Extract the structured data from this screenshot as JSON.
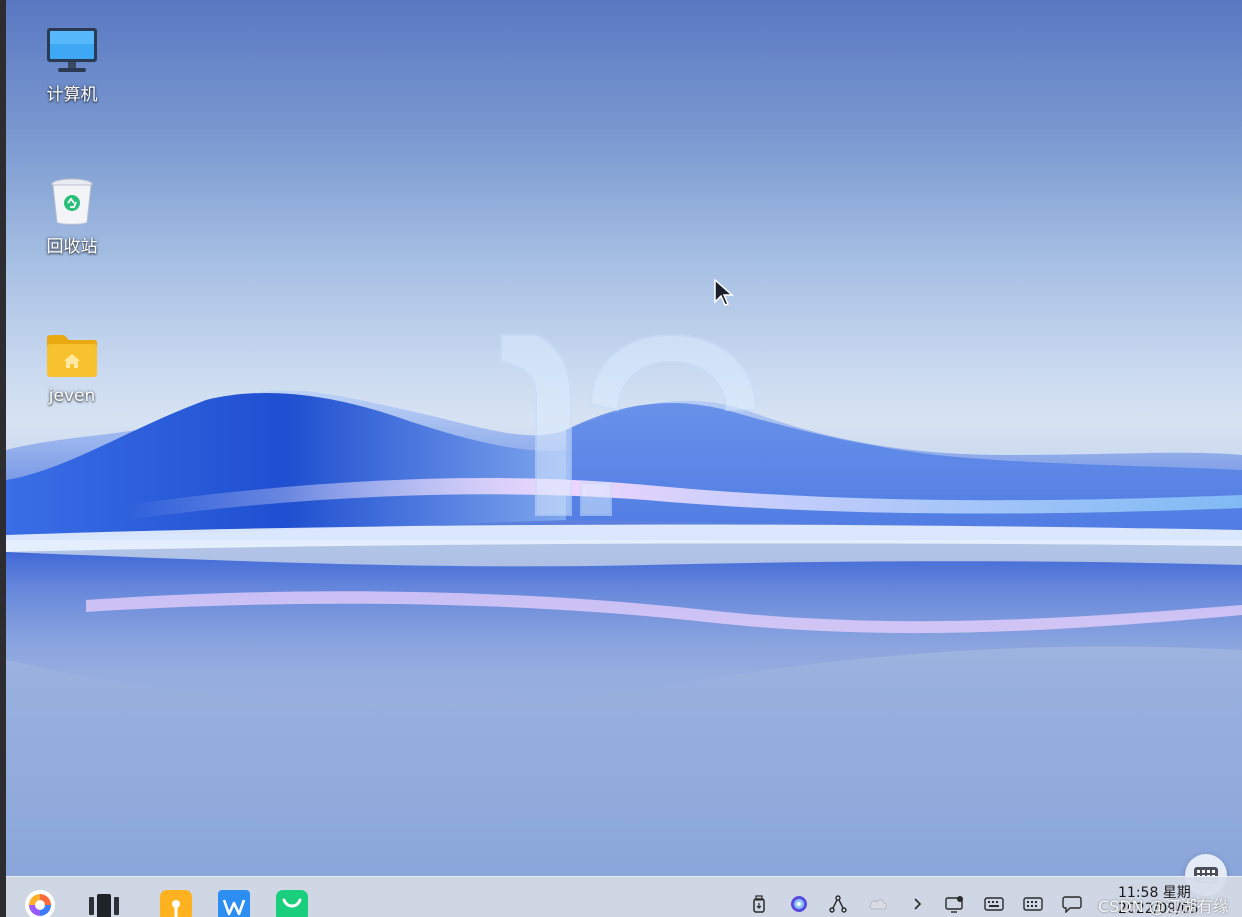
{
  "desktop": {
    "icons": [
      {
        "label": "计算机",
        "icon": "computer-icon"
      },
      {
        "label": "回收站",
        "icon": "trash-icon"
      },
      {
        "label": "jeven",
        "icon": "home-folder-icon"
      }
    ],
    "wallpaper_mark": "12"
  },
  "taskbar": {
    "apps": [
      {
        "icon": "start-menu-icon"
      },
      {
        "icon": "multitask-view-icon"
      },
      {
        "icon": "file-manager-icon"
      },
      {
        "icon": "wps-office-icon"
      },
      {
        "icon": "software-store-icon"
      }
    ],
    "tray": [
      {
        "icon": "usb-drive-icon"
      },
      {
        "icon": "assistant-icon"
      },
      {
        "icon": "network-icon"
      },
      {
        "icon": "cloud-icon"
      },
      {
        "icon": "expand-arrow-icon"
      },
      {
        "icon": "display-settings-icon"
      },
      {
        "icon": "input-method-icon"
      },
      {
        "icon": "keyboard-icon"
      },
      {
        "icon": "notification-icon"
      }
    ],
    "clock_time": "11:58 星期",
    "clock_date": "2022/09/05"
  },
  "watermark": "CSDN @江湖有缘",
  "colors": {
    "sky_top": "#5a78c2",
    "sky_mid": "#c9d9ef",
    "wave_blue": "#2f5fd8",
    "taskbar_bg": "#d6dfec",
    "folder_yellow": "#f7c22e"
  }
}
